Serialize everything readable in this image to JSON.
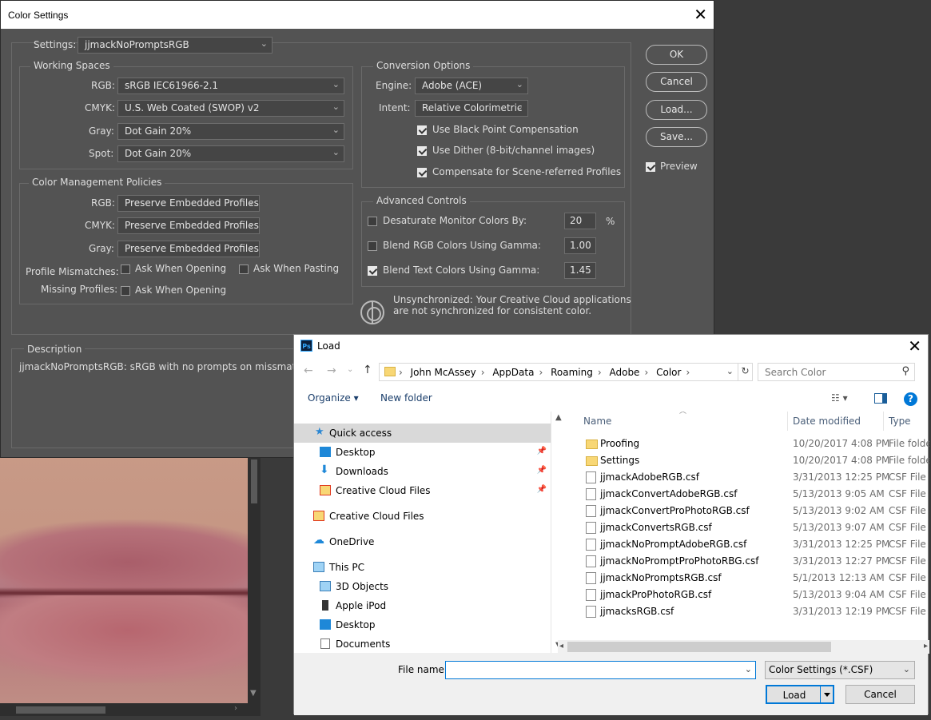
{
  "colorSettings": {
    "title": "Color Settings",
    "settings_label": "Settings:",
    "settings_value": "jjmackNoPromptsRGB",
    "working_spaces": {
      "title": "Working Spaces",
      "rgb_label": "RGB:",
      "rgb_value": "sRGB IEC61966-2.1",
      "cmyk_label": "CMYK:",
      "cmyk_value": "U.S. Web Coated (SWOP) v2",
      "gray_label": "Gray:",
      "gray_value": "Dot Gain 20%",
      "spot_label": "Spot:",
      "spot_value": "Dot Gain 20%"
    },
    "policies": {
      "title": "Color Management Policies",
      "rgb_label": "RGB:",
      "rgb_value": "Preserve Embedded Profiles",
      "cmyk_label": "CMYK:",
      "cmyk_value": "Preserve Embedded Profiles",
      "gray_label": "Gray:",
      "gray_value": "Preserve Embedded Profiles",
      "mismatch_label": "Profile Mismatches:",
      "ask_opening": "Ask When Opening",
      "ask_pasting": "Ask When Pasting",
      "missing_label": "Missing Profiles:",
      "ask_opening_missing": "Ask When Opening"
    },
    "conversion": {
      "title": "Conversion Options",
      "engine_label": "Engine:",
      "engine_value": "Adobe (ACE)",
      "intent_label": "Intent:",
      "intent_value": "Relative Colorimetric",
      "black_point": "Use Black Point Compensation",
      "dither": "Use Dither (8-bit/channel images)",
      "scene_referred": "Compensate for Scene-referred Profiles"
    },
    "advanced": {
      "title": "Advanced Controls",
      "desaturate_label": "Desaturate Monitor Colors By:",
      "desaturate_value": "20",
      "desaturate_unit": "%",
      "blend_rgb_label": "Blend RGB Colors Using Gamma:",
      "blend_rgb_value": "1.00",
      "blend_text_label": "Blend Text Colors Using Gamma:",
      "blend_text_value": "1.45"
    },
    "sync_message_line1": "Unsynchronized: Your Creative Cloud applications",
    "sync_message_line2": "are not synchronized for consistent color.",
    "description_title": "Description",
    "description_text": "jjmackNoPromptsRGB:  sRGB with no prompts on missmatch",
    "buttons": {
      "ok": "OK",
      "cancel": "Cancel",
      "load": "Load...",
      "save": "Save...",
      "preview": "Preview"
    }
  },
  "loadDialog": {
    "title": "Load",
    "breadcrumb": [
      "John McAssey",
      "AppData",
      "Roaming",
      "Adobe",
      "Color"
    ],
    "search_placeholder": "Search Color",
    "organize": "Organize ▾",
    "new_folder": "New folder",
    "tree": [
      {
        "label": "Quick access",
        "icon": "star-icon"
      },
      {
        "label": "Desktop",
        "icon": "desktop-icon"
      },
      {
        "label": "Downloads",
        "icon": "download-icon"
      },
      {
        "label": "Creative Cloud Files",
        "icon": "creative-cloud-icon"
      },
      {
        "label": "Creative Cloud Files",
        "icon": "creative-cloud-icon"
      },
      {
        "label": "OneDrive",
        "icon": "cloud-icon"
      },
      {
        "label": "This PC",
        "icon": "computer-icon"
      },
      {
        "label": "3D Objects",
        "icon": "cube-icon"
      },
      {
        "label": "Apple iPod",
        "icon": "ipod-icon"
      },
      {
        "label": "Desktop",
        "icon": "desktop-icon"
      },
      {
        "label": "Documents",
        "icon": "document-icon"
      }
    ],
    "columns": {
      "name": "Name",
      "date": "Date modified",
      "type": "Type"
    },
    "files": [
      {
        "name": "Proofing",
        "date": "10/20/2017 4:08 PM",
        "type": "File folder",
        "kind": "folder"
      },
      {
        "name": "Settings",
        "date": "10/20/2017 4:08 PM",
        "type": "File folder",
        "kind": "folder"
      },
      {
        "name": "jjmackAdobeRGB.csf",
        "date": "3/31/2013 12:25 PM",
        "type": "CSF File",
        "kind": "file"
      },
      {
        "name": "jjmackConvertAdobeRGB.csf",
        "date": "5/13/2013 9:05 AM",
        "type": "CSF File",
        "kind": "file"
      },
      {
        "name": "jjmackConvertProPhotoRGB.csf",
        "date": "5/13/2013 9:02 AM",
        "type": "CSF File",
        "kind": "file"
      },
      {
        "name": "jjmackConvertsRGB.csf",
        "date": "5/13/2013 9:07 AM",
        "type": "CSF File",
        "kind": "file"
      },
      {
        "name": "jjmackNoPromptAdobeRGB.csf",
        "date": "3/31/2013 12:25 PM",
        "type": "CSF File",
        "kind": "file"
      },
      {
        "name": "jjmackNoPromptProPhotoRBG.csf",
        "date": "3/31/2013 12:27 PM",
        "type": "CSF File",
        "kind": "file"
      },
      {
        "name": "jjmackNoPromptsRGB.csf",
        "date": "5/1/2013 12:13 AM",
        "type": "CSF File",
        "kind": "file"
      },
      {
        "name": "jjmackProPhotoRGB.csf",
        "date": "5/13/2013 9:04 AM",
        "type": "CSF File",
        "kind": "file"
      },
      {
        "name": "jjmacksRGB.csf",
        "date": "3/31/2013 12:19 PM",
        "type": "CSF File",
        "kind": "file"
      }
    ],
    "file_name_label": "File name:",
    "file_name_value": "",
    "filter_value": "Color Settings (*.CSF)",
    "load_button": "Load",
    "cancel_button": "Cancel"
  }
}
